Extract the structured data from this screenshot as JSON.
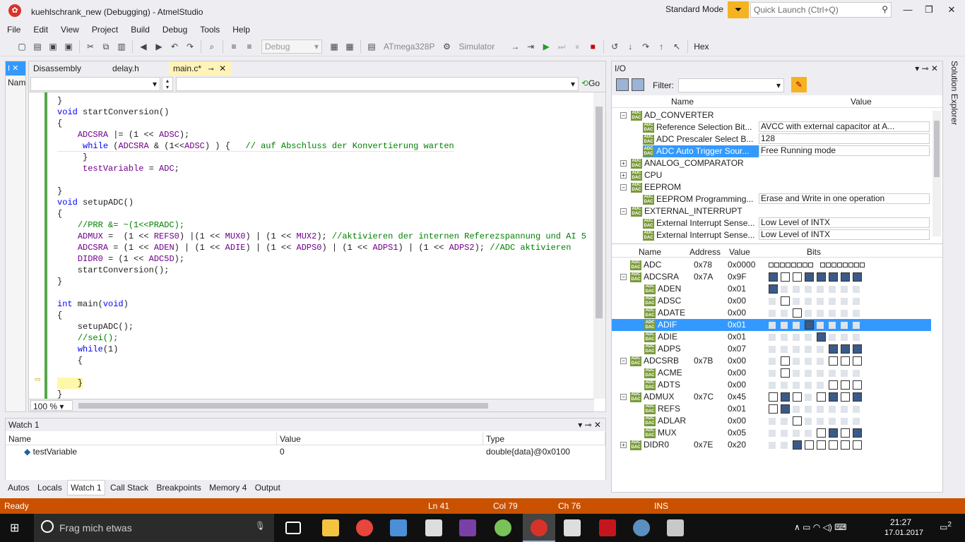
{
  "title": "kuehlschrank_new (Debugging) - AtmelStudio",
  "standard_mode": "Standard Mode",
  "quick_launch": "Quick Launch (Ctrl+Q)",
  "menu": [
    "File",
    "Edit",
    "View",
    "Project",
    "Build",
    "Debug",
    "Tools",
    "Help"
  ],
  "toolbar": {
    "config": "Debug",
    "device": "ATmega328P",
    "tool": "Simulator",
    "hex": "Hex"
  },
  "tabs": [
    {
      "label": "Disassembly"
    },
    {
      "label": "delay.h"
    },
    {
      "label": "main.c*"
    }
  ],
  "nav_go": "Go",
  "leftstrip_label": "Nam",
  "code_lines": [
    "}",
    "void startConversion()",
    "{",
    "    ADCSRA |= (1 << ADSC);",
    "     while (ADCSRA & (1<<ADSC) ) {   // auf Abschluss der Konvertierung warten",
    "     }",
    "     testVariable = ADC;",
    "",
    "}",
    "void setupADC()",
    "{",
    "    //PRR &= ~(1<<PRADC);",
    "    ADMUX =  (1 << REFS0) |(1 << MUX0) | (1 << MUX2); //aktivieren der internen Referezspannung und AI 5",
    "    ADCSRA = (1 << ADEN) | (1 << ADIE) | (1 << ADPS0) | (1 << ADPS1) | (1 << ADPS2); //ADC aktivieren",
    "    DIDR0 = (1 << ADC5D);",
    "    startConversion();",
    "}",
    "",
    "int main(void)",
    "{",
    "    setupADC();",
    "    //sei();",
    "    while(1)",
    "    {",
    "",
    "    }",
    "}"
  ],
  "zoom": "100 %",
  "watch": {
    "title": "Watch 1",
    "cols": [
      "Name",
      "Value",
      "Type"
    ],
    "rows": [
      {
        "name": "testVariable",
        "value": "0",
        "type": "double{data}@0x0100"
      }
    ]
  },
  "bottom_tabs": [
    "Autos",
    "Locals",
    "Watch 1",
    "Call Stack",
    "Breakpoints",
    "Memory 4",
    "Output"
  ],
  "io": {
    "title": "I/O",
    "filter_label": "Filter:",
    "cols": [
      "Name",
      "Value"
    ],
    "modules": [
      {
        "name": "AD_CONVERTER",
        "exp": "−"
      },
      {
        "name": "Reference Selection Bit...",
        "value": "AVCC with external capacitor at A...",
        "child": true
      },
      {
        "name": "ADC  Prescaler Select B...",
        "value": "128",
        "child": true
      },
      {
        "name": "ADC Auto Trigger Sour...",
        "value": "Free Running mode",
        "child": true,
        "sel": true
      },
      {
        "name": "ANALOG_COMPARATOR",
        "exp": "+"
      },
      {
        "name": "CPU",
        "exp": "+"
      },
      {
        "name": "EEPROM",
        "exp": "−"
      },
      {
        "name": "EEPROM Programming...",
        "value": "Erase and Write in one operation",
        "child": true
      },
      {
        "name": "EXTERNAL_INTERRUPT",
        "exp": "−"
      },
      {
        "name": "External Interrupt Sense...",
        "value": "Low Level of INTX",
        "child": true
      },
      {
        "name": "External Interrupt Sense...",
        "value": "Low Level of INTX",
        "child": true
      }
    ],
    "reg_cols": [
      "Name",
      "Address",
      "Value",
      "Bits"
    ],
    "registers": [
      {
        "name": "ADC",
        "addr": "0x78",
        "val": "0x0000",
        "bits": "wide"
      },
      {
        "name": "ADCSRA",
        "addr": "0x7A",
        "val": "0x9F",
        "exp": "−",
        "bits": [
          1,
          0,
          0,
          1,
          1,
          1,
          1,
          1
        ]
      },
      {
        "name": "ADEN",
        "val": "0x01",
        "child": true,
        "bits": [
          1,
          -1,
          -1,
          -1,
          -1,
          -1,
          -1,
          -1
        ]
      },
      {
        "name": "ADSC",
        "val": "0x00",
        "child": true,
        "bits": [
          -1,
          0,
          -1,
          -1,
          -1,
          -1,
          -1,
          -1
        ]
      },
      {
        "name": "ADATE",
        "val": "0x00",
        "child": true,
        "bits": [
          -1,
          -1,
          0,
          -1,
          -1,
          -1,
          -1,
          -1
        ]
      },
      {
        "name": "ADIF",
        "val": "0x01",
        "child": true,
        "sel": true,
        "bits": [
          -1,
          -1,
          -1,
          1,
          -1,
          -1,
          -1,
          -1
        ]
      },
      {
        "name": "ADIE",
        "val": "0x01",
        "child": true,
        "bits": [
          -1,
          -1,
          -1,
          -1,
          1,
          -1,
          -1,
          -1
        ]
      },
      {
        "name": "ADPS",
        "val": "0x07",
        "child": true,
        "bits": [
          -1,
          -1,
          -1,
          -1,
          -1,
          1,
          1,
          1
        ]
      },
      {
        "name": "ADCSRB",
        "addr": "0x7B",
        "val": "0x00",
        "exp": "−",
        "bits": [
          -1,
          0,
          -1,
          -1,
          -1,
          0,
          0,
          0
        ]
      },
      {
        "name": "ACME",
        "val": "0x00",
        "child": true,
        "bits": [
          -1,
          0,
          -1,
          -1,
          -1,
          -1,
          -1,
          -1
        ]
      },
      {
        "name": "ADTS",
        "val": "0x00",
        "child": true,
        "bits": [
          -1,
          -1,
          -1,
          -1,
          -1,
          0,
          0,
          0
        ]
      },
      {
        "name": "ADMUX",
        "addr": "0x7C",
        "val": "0x45",
        "exp": "−",
        "bits": [
          0,
          1,
          0,
          -1,
          0,
          1,
          0,
          1
        ]
      },
      {
        "name": "REFS",
        "val": "0x01",
        "child": true,
        "bits": [
          0,
          1,
          -1,
          -1,
          -1,
          -1,
          -1,
          -1
        ]
      },
      {
        "name": "ADLAR",
        "val": "0x00",
        "child": true,
        "bits": [
          -1,
          -1,
          0,
          -1,
          -1,
          -1,
          -1,
          -1
        ]
      },
      {
        "name": "MUX",
        "val": "0x05",
        "child": true,
        "bits": [
          -1,
          -1,
          -1,
          -1,
          0,
          1,
          0,
          1
        ]
      },
      {
        "name": "DIDR0",
        "addr": "0x7E",
        "val": "0x20",
        "exp": "+",
        "bits": [
          -1,
          -1,
          1,
          0,
          0,
          0,
          0,
          0
        ]
      }
    ]
  },
  "solution_explorer": "Solution Explorer",
  "status": {
    "ready": "Ready",
    "ln": "Ln 41",
    "col": "Col 79",
    "ch": "Ch 76",
    "ins": "INS"
  },
  "taskbar": {
    "search": "Frag mich etwas",
    "time": "21:27",
    "date": "17.01.2017",
    "notif": "2"
  },
  "colors": {
    "status": "#ca5100",
    "accent": "#3399ff",
    "adc_icon": "#7a9a3a"
  }
}
